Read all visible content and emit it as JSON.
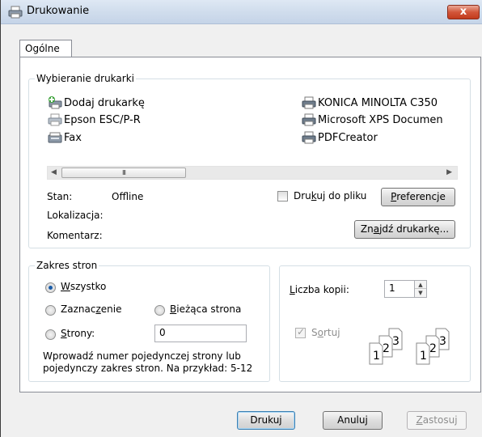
{
  "window": {
    "title": "Drukowanie",
    "close_label": "x"
  },
  "tabs": [
    {
      "label": "Ogólne"
    }
  ],
  "printer_group": {
    "legend": "Wybieranie drukarki",
    "printers": [
      {
        "name": "Dodaj drukarkę",
        "icon": "add-printer-icon"
      },
      {
        "name": "Epson ESC/P-R",
        "icon": "printer-icon"
      },
      {
        "name": "Fax",
        "icon": "fax-icon"
      },
      {
        "name": "KONICA MINOLTA C350",
        "icon": "printer-icon"
      },
      {
        "name": "Microsoft XPS Documen",
        "icon": "printer-icon"
      },
      {
        "name": "PDFCreator",
        "icon": "printer-icon"
      }
    ],
    "scrollbar_grip": "III",
    "status_label": "Stan:",
    "status_value": "Offline",
    "location_label": "Lokalizacja:",
    "comment_label": "Komentarz:",
    "print_to_file_pre": "Dru",
    "print_to_file_key": "k",
    "print_to_file_post": "uj do pliku",
    "preferences_key": "P",
    "preferences_post": "referencje",
    "find_printer_pre": "Zn",
    "find_printer_key": "a",
    "find_printer_post": "jdź drukarkę..."
  },
  "page_range_group": {
    "legend": "Zakres stron",
    "all_key": "W",
    "all_post": "szystko",
    "selection_pre": "Zaznac",
    "selection_key": "z",
    "selection_post": "enie",
    "current_key": "B",
    "current_post": "ieżąca strona",
    "pages_key": "S",
    "pages_post": "trony:",
    "pages_value": "0",
    "hint_line1": "Wprowadź numer pojedynczej strony lub",
    "hint_line2": "pojedynczy zakres stron. Na przykład: 5-12",
    "selected": "all"
  },
  "copies_group": {
    "copies_key": "L",
    "copies_post": "iczba kopii:",
    "copies_value": "1",
    "collate_pre": "S",
    "collate_key": "o",
    "collate_post": "rtuj",
    "collate_checked": true,
    "collate_enabled": false
  },
  "buttons": {
    "print": "Drukuj",
    "cancel": "Anuluj",
    "apply_key": "Z",
    "apply_post": "astosuj"
  }
}
